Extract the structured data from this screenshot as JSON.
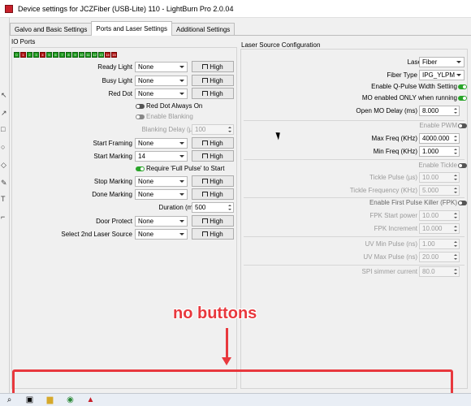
{
  "window": {
    "title": "Device settings for JCZFiber (USB-Lite) 110 - LightBurn Pro 2.0.04"
  },
  "tabs": [
    {
      "label": "Galvo and Basic Settings"
    },
    {
      "label": "Ports and Laser Settings"
    },
    {
      "label": "Additional Settings"
    }
  ],
  "io": {
    "title": "IO Ports",
    "leds": [
      "0",
      "1",
      "2",
      "3",
      "4",
      "5",
      "6",
      "7",
      "8",
      "9",
      "10",
      "11",
      "12",
      "13",
      "14",
      "15"
    ],
    "high_label": "High",
    "rows": [
      {
        "label": "Ready Light",
        "value": "None"
      },
      {
        "label": "Busy Light",
        "value": "None"
      },
      {
        "label": "Red Dot",
        "value": "None"
      }
    ],
    "red_dot_always_on": "Red Dot Always On",
    "enable_blanking": "Enable Blanking",
    "blanking_delay": {
      "label": "Blanking Delay (µs)",
      "value": "100"
    },
    "start_framing": {
      "label": "Start Framing",
      "value": "None"
    },
    "start_marking": {
      "label": "Start Marking",
      "value": "14"
    },
    "require_full_pulse": "Require 'Full Pulse' to Start",
    "stop_marking": {
      "label": "Stop Marking",
      "value": "None"
    },
    "done_marking": {
      "label": "Done Marking",
      "value": "None"
    },
    "duration": {
      "label": "Duration (ms)",
      "value": "500"
    },
    "door_protect": {
      "label": "Door Protect",
      "value": "None"
    },
    "select_2nd": {
      "label": "Select 2nd Laser Source",
      "value": "None"
    }
  },
  "laser": {
    "title": "Laser Source Configuration",
    "laser_type": {
      "label": "Laser Type",
      "value": "Fiber"
    },
    "fiber_type": {
      "label": "Fiber Type",
      "value": "IPG_YLPM"
    },
    "enable_q_pulse": "Enable Q-Pulse Width Setting",
    "mo_enabled": "MO enabled ONLY when running",
    "open_mo_delay": {
      "label": "Open MO Delay (ms)",
      "value": "8.000"
    },
    "enable_pwm": "Enable PWM",
    "max_freq": {
      "label": "Max Freq (KHz)",
      "value": "4000.000"
    },
    "min_freq": {
      "label": "Min Freq (KHz)",
      "value": "1.000"
    },
    "enable_tickle": "Enable Tickle",
    "tickle_pulse": {
      "label": "Tickle Pulse (µs)",
      "value": "10.00"
    },
    "tickle_freq": {
      "label": "Tickle Frequency (KHz)",
      "value": "5.000"
    },
    "enable_fpk": "Enable First Pulse Killer (FPK)",
    "fpk_start": {
      "label": "FPK Start power",
      "value": "10.00"
    },
    "fpk_increment": {
      "label": "FPK Increment",
      "value": "10.000"
    },
    "uv_min": {
      "label": "UV Min Pulse (ns)",
      "value": "1.00"
    },
    "uv_max": {
      "label": "UV Max Pulse (ns)",
      "value": "20.00"
    },
    "spi_simmer": {
      "label": "SPI simmer current",
      "value": "80.0"
    }
  },
  "annotation": {
    "text": "no buttons",
    "color": "#e8383d"
  },
  "colors": {
    "led_on": "#1e9b1e",
    "led_off": "#b01818",
    "toggle_on": "#2aa52a"
  }
}
